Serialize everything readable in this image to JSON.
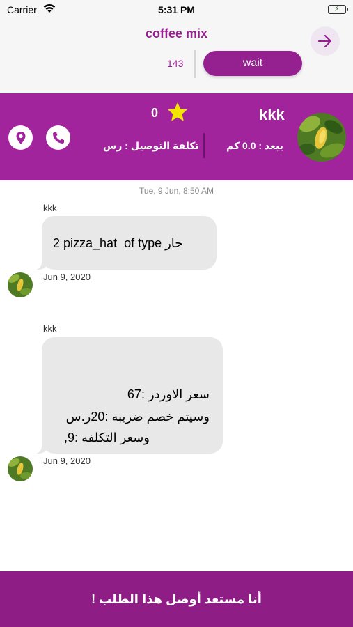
{
  "status_bar": {
    "carrier": "Carrier",
    "time": "5:31 PM"
  },
  "header": {
    "title": "coffee mix",
    "count": "143",
    "wait_label": "wait"
  },
  "info_band": {
    "name": "kkk",
    "rating": "0",
    "distance": "يبعد : 0.0 كم",
    "delivery_cost": "تكلفة التوصيل : رس"
  },
  "chat": {
    "day_stamp": "Tue, 9 Jun, 8:50 AM",
    "messages": [
      {
        "sender": "kkk",
        "text": "2 pizza_hat  of type حار",
        "date": "Jun 9, 2020"
      },
      {
        "sender": "kkk",
        "lines": [
          "سعر الاوردر :67",
          "وسيتم خصم ضريبه :20ر.س",
          "وسعر التكلفه :9,"
        ],
        "date": "Jun 9, 2020"
      }
    ]
  },
  "cta_label": "أنا مستعد أوصل هذا الطلب !",
  "colors": {
    "brand_purple": "#a1249d",
    "cta_purple": "#8e1e86",
    "star_yellow": "#f2e600"
  },
  "icons": [
    "wifi-icon",
    "battery-icon",
    "arrow-right-icon",
    "location-pin-icon",
    "phone-icon",
    "star-icon"
  ]
}
